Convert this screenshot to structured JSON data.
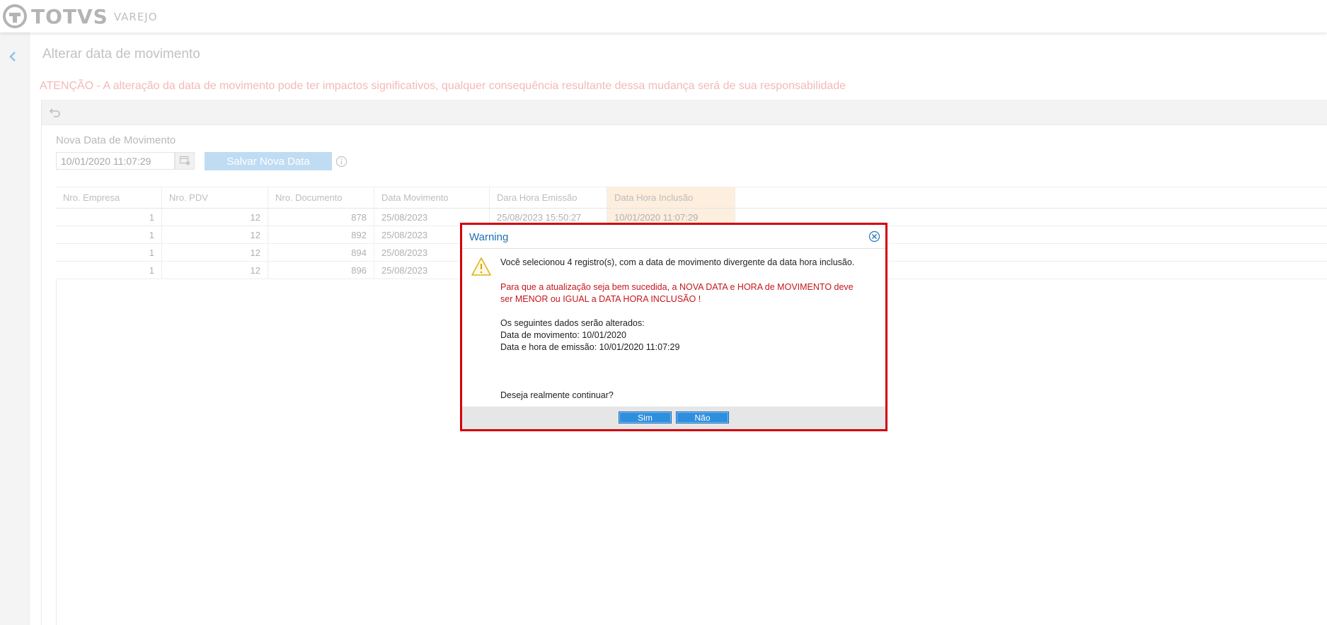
{
  "header": {
    "brand": "TOTVS",
    "brand_sub": "VAREJO"
  },
  "nav": {
    "back_icon": "chevron-left-icon"
  },
  "page": {
    "title": "Alterar data de movimento",
    "warning": "ATENÇÃO - A alteração da data de movimento pode ter impactos significativos, qualquer consequência resultante dessa mudança será de sua responsabilidade"
  },
  "form": {
    "label": "Nova Data de Movimento",
    "date_value": "10/01/2020 11:07:29",
    "save_label": "Salvar Nova Data"
  },
  "grid": {
    "columns": [
      "Nro. Empresa",
      "Nro. PDV",
      "Nro. Documento",
      "Data Movimento",
      "Dara Hora Emissão",
      "Data Hora Inclusão"
    ],
    "rows": [
      [
        "1",
        "12",
        "878",
        "25/08/2023",
        "25/08/2023 15:50:27",
        "10/01/2020 11:07:29"
      ],
      [
        "1",
        "12",
        "892",
        "25/08/2023",
        "",
        ""
      ],
      [
        "1",
        "12",
        "894",
        "25/08/2023",
        "",
        ""
      ],
      [
        "1",
        "12",
        "896",
        "25/08/2023",
        "",
        ""
      ]
    ]
  },
  "modal": {
    "title": "Warning",
    "line1": "Você selecionou 4 registro(s), com a data de movimento divergente da data hora inclusão.",
    "red_line1": "Para que a atualização seja bem sucedida, a NOVA DATA e HORA de MOVIMENTO deve",
    "red_line2": "ser MENOR ou IGUAL a DATA HORA INCLUSÃO !",
    "changes_intro": "Os seguintes dados serão alterados:",
    "change1": "Data de movimento: 10/01/2020",
    "change2": "Data e hora de emissão: 10/01/2020 11:07:29",
    "question": "Deseja realmente continuar?",
    "yes_label": "Sim",
    "no_label": "Não"
  },
  "colors": {
    "modal_border": "#d1000b",
    "modal_title": "#1e6fb0",
    "alert_text": "#c5171c",
    "button_blue": "#2f8fdf",
    "highlight_column": "#fdeede"
  }
}
